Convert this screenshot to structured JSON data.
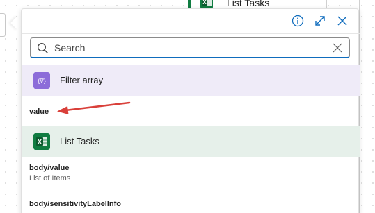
{
  "background": {
    "card_title": "List Tasks"
  },
  "header": {
    "info_icon": "info-icon",
    "expand_icon": "expand-icon",
    "close_icon": "close-icon"
  },
  "search": {
    "placeholder": "Search",
    "value": ""
  },
  "sections": [
    {
      "title": "Filter array",
      "icon": "filter-array-icon",
      "icon_glyph": "{∇}",
      "color": "#8c6cd9",
      "items": [
        {
          "title": "value",
          "subtitle": ""
        }
      ]
    },
    {
      "title": "List Tasks",
      "icon": "excel-icon",
      "icon_glyph": "X",
      "color": "#107c41",
      "items": [
        {
          "title": "body/value",
          "subtitle": "List of Items"
        },
        {
          "title": "body/sensitivityLabelInfo",
          "subtitle": ""
        }
      ]
    }
  ],
  "colors": {
    "accent": "#0f6cbd",
    "arrow": "#d9403a"
  }
}
